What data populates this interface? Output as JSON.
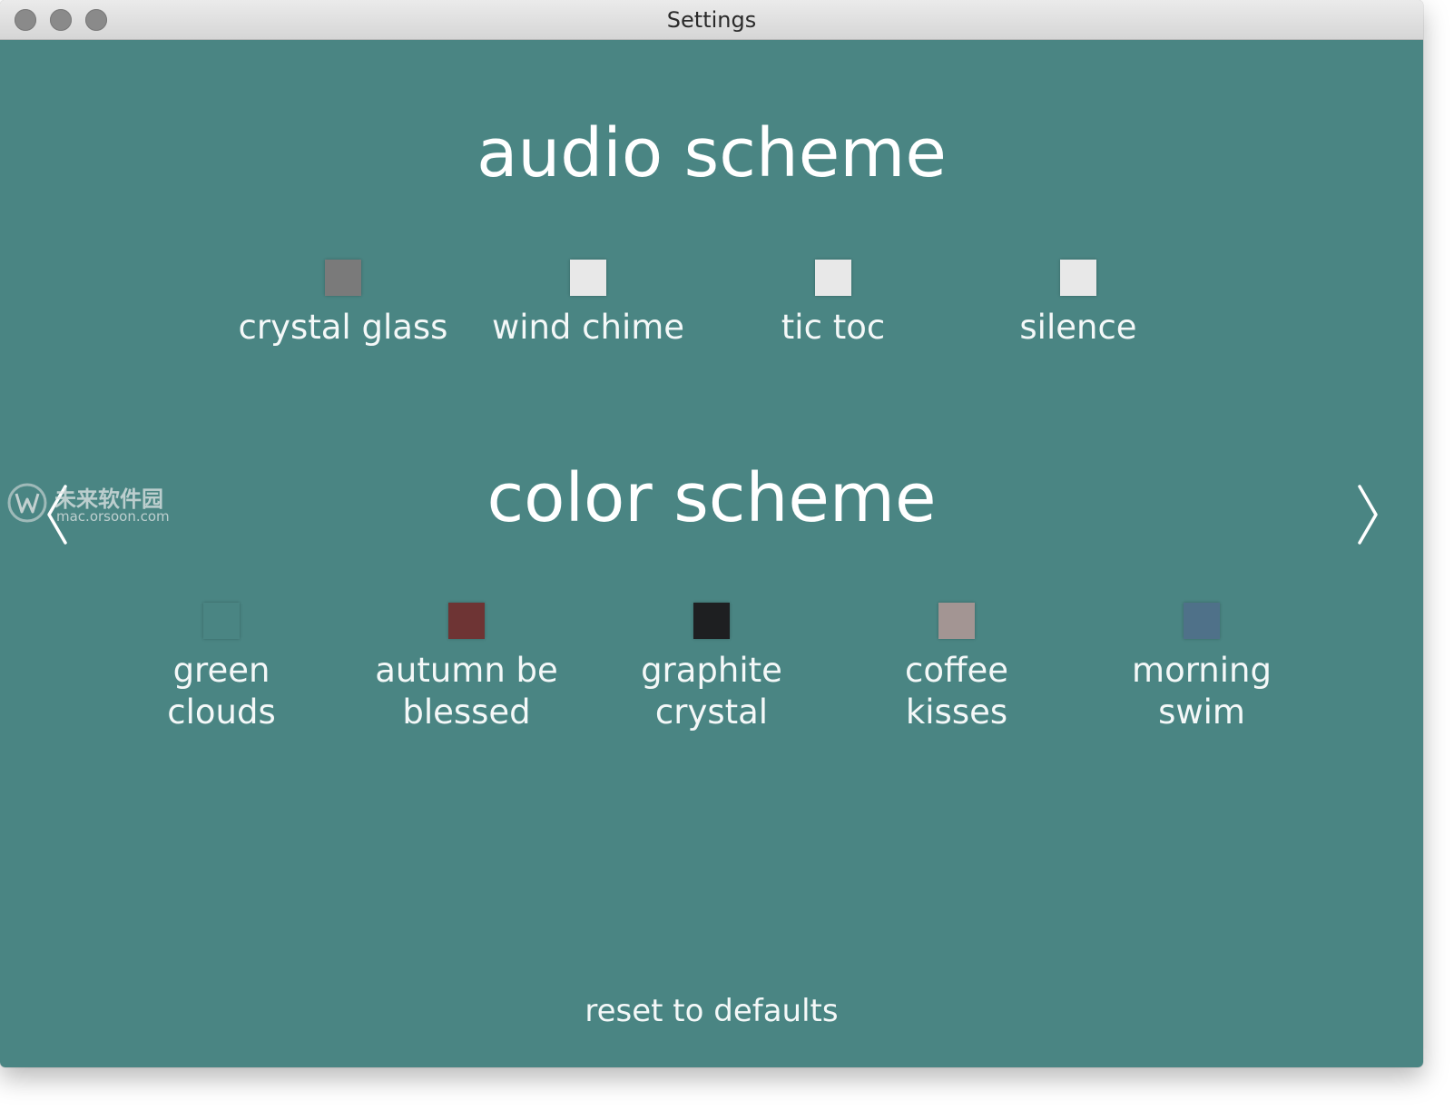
{
  "window": {
    "title": "Settings"
  },
  "audio": {
    "title": "audio scheme",
    "options": [
      {
        "label": "crystal glass",
        "color": "#7a7a7a",
        "selected": true
      },
      {
        "label": "wind chime",
        "color": "#e8e8e8",
        "selected": false
      },
      {
        "label": "tic toc",
        "color": "#e8e8e8",
        "selected": false
      },
      {
        "label": "silence",
        "color": "#e8e8e8",
        "selected": false
      }
    ]
  },
  "color": {
    "title": "color scheme",
    "options": [
      {
        "label_line1": "green",
        "label_line2": "clouds",
        "color": "#4a8583"
      },
      {
        "label_line1": "autumn be",
        "label_line2": "blessed",
        "color": "#6e3434"
      },
      {
        "label_line1": "graphite",
        "label_line2": "crystal",
        "color": "#1e1f21"
      },
      {
        "label_line1": "coffee",
        "label_line2": "kisses",
        "color": "#a39593"
      },
      {
        "label_line1": "morning",
        "label_line2": "swim",
        "color": "#4f7189"
      }
    ]
  },
  "nav": {
    "prev_icon": "chevron-left-icon",
    "next_icon": "chevron-right-icon"
  },
  "footer": {
    "reset_label": "reset to defaults"
  },
  "watermark": {
    "text": "未来软件园",
    "url": "mac.orsoon.com"
  },
  "colors": {
    "background": "#4a8583",
    "text": "#ffffff"
  }
}
